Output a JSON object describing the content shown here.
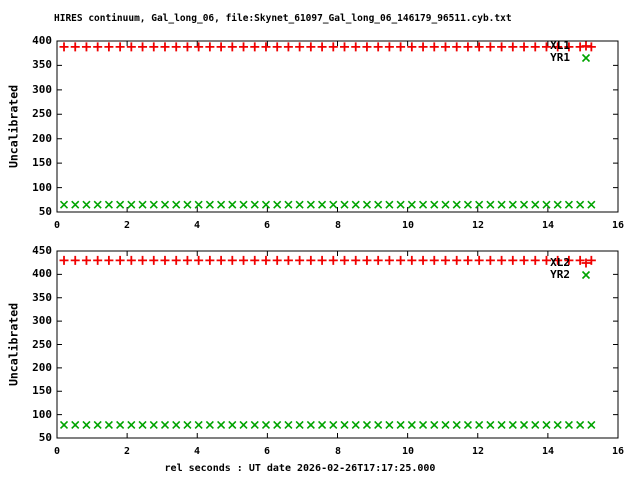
{
  "title": "HIRES continuum, Gal_long_06, file:Skynet_61097_Gal_long_06_146179_96511.cyb.txt",
  "xlabel": "rel seconds : UT date 2026-02-26T17:17:25.000",
  "colors": {
    "plus_series": "#f00000",
    "x_series": "#00a400",
    "frame": "#000000",
    "text": "#000000",
    "background": "#ffffff"
  },
  "chart_data": [
    {
      "type": "scatter",
      "panel": "top",
      "title": "HIRES continuum, Gal_long_06, file:Skynet_61097_Gal_long_06_146179_96511.cyb.txt",
      "ylabel": "Uncalibrated",
      "xlabel": "",
      "ylim": [
        50,
        400
      ],
      "yticks": [
        50,
        100,
        150,
        200,
        250,
        300,
        350,
        400
      ],
      "xlim": [
        0,
        16
      ],
      "xticks": [
        0,
        2,
        4,
        6,
        8,
        10,
        12,
        14,
        16
      ],
      "grid": false,
      "legend_position": "top-right",
      "x": [
        0.2,
        0.52,
        0.84,
        1.16,
        1.48,
        1.8,
        2.12,
        2.44,
        2.76,
        3.08,
        3.4,
        3.72,
        4.04,
        4.36,
        4.68,
        5.0,
        5.32,
        5.64,
        5.96,
        6.28,
        6.6,
        6.92,
        7.24,
        7.56,
        7.88,
        8.2,
        8.52,
        8.84,
        9.16,
        9.48,
        9.8,
        10.12,
        10.44,
        10.76,
        11.08,
        11.4,
        11.72,
        12.04,
        12.36,
        12.68,
        13.0,
        13.32,
        13.64,
        13.96,
        14.28,
        14.6,
        14.92,
        15.24
      ],
      "series": [
        {
          "name": "XL1",
          "marker": "plus",
          "color": "#f00000",
          "y_constant": 388
        },
        {
          "name": "YR1",
          "marker": "x",
          "color": "#00a400",
          "y_constant": 65
        }
      ]
    },
    {
      "type": "scatter",
      "panel": "bottom",
      "title": "",
      "ylabel": "Uncalibrated",
      "xlabel": "rel seconds : UT date 2026-02-26T17:17:25.000",
      "ylim": [
        50,
        450
      ],
      "yticks": [
        50,
        100,
        150,
        200,
        250,
        300,
        350,
        400,
        450
      ],
      "xlim": [
        0,
        16
      ],
      "xticks": [
        0,
        2,
        4,
        6,
        8,
        10,
        12,
        14,
        16
      ],
      "grid": false,
      "legend_position": "top-right",
      "x": [
        0.2,
        0.52,
        0.84,
        1.16,
        1.48,
        1.8,
        2.12,
        2.44,
        2.76,
        3.08,
        3.4,
        3.72,
        4.04,
        4.36,
        4.68,
        5.0,
        5.32,
        5.64,
        5.96,
        6.28,
        6.6,
        6.92,
        7.24,
        7.56,
        7.88,
        8.2,
        8.52,
        8.84,
        9.16,
        9.48,
        9.8,
        10.12,
        10.44,
        10.76,
        11.08,
        11.4,
        11.72,
        12.04,
        12.36,
        12.68,
        13.0,
        13.32,
        13.64,
        13.96,
        14.28,
        14.6,
        14.92,
        15.24
      ],
      "series": [
        {
          "name": "XL2",
          "marker": "plus",
          "color": "#f00000",
          "y_constant": 430
        },
        {
          "name": "YR2",
          "marker": "x",
          "color": "#00a400",
          "y_constant": 78
        }
      ]
    }
  ]
}
